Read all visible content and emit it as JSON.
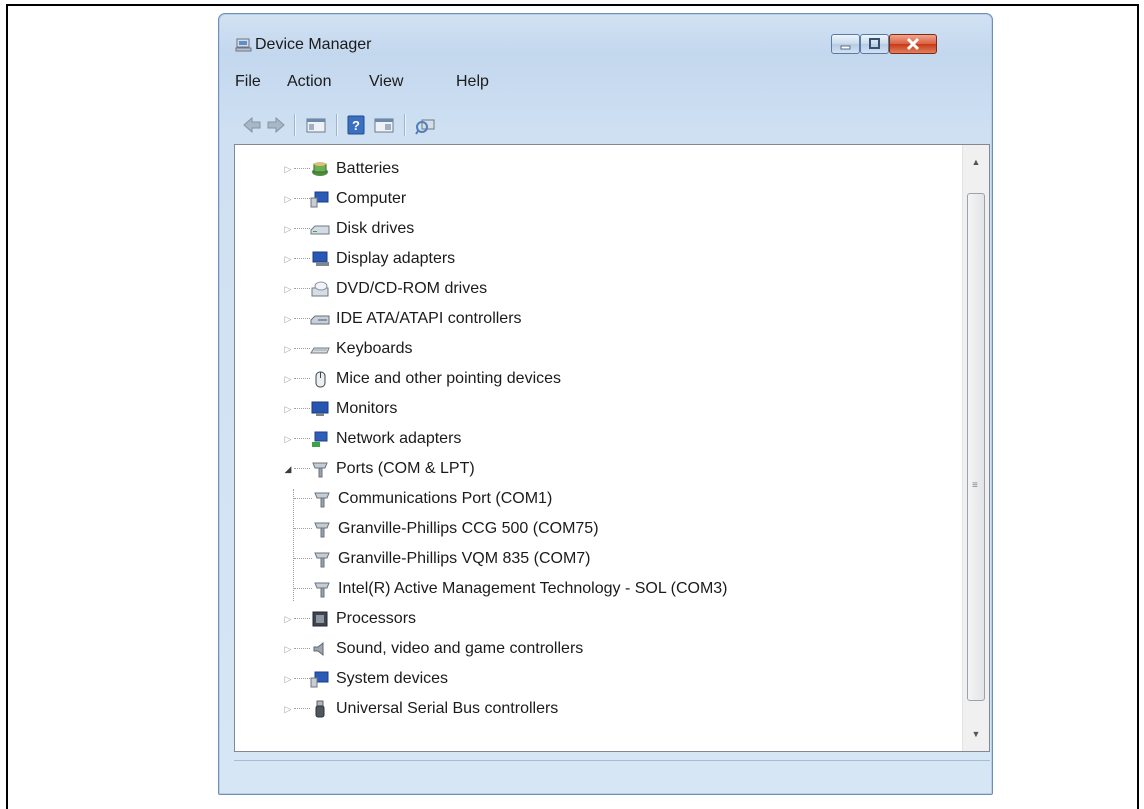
{
  "window": {
    "title": "Device Manager"
  },
  "menu": {
    "items": [
      "File",
      "Action",
      "View",
      "Help"
    ]
  },
  "toolbar": {
    "icons": [
      "back-arrow-icon",
      "forward-arrow-icon",
      "show-hide-console-tree-icon",
      "help-icon",
      "properties-icon",
      "scan-hardware-icon"
    ]
  },
  "tree": {
    "categories": [
      {
        "label": "Batteries",
        "icon": "battery-icon",
        "expanded": false
      },
      {
        "label": "Computer",
        "icon": "computer-icon",
        "expanded": false
      },
      {
        "label": "Disk drives",
        "icon": "disk-drive-icon",
        "expanded": false
      },
      {
        "label": "Display adapters",
        "icon": "display-adapter-icon",
        "expanded": false
      },
      {
        "label": "DVD/CD-ROM drives",
        "icon": "dvd-drive-icon",
        "expanded": false
      },
      {
        "label": "IDE ATA/ATAPI controllers",
        "icon": "ide-controller-icon",
        "expanded": false
      },
      {
        "label": "Keyboards",
        "icon": "keyboard-icon",
        "expanded": false
      },
      {
        "label": "Mice and other pointing devices",
        "icon": "mouse-icon",
        "expanded": false
      },
      {
        "label": "Monitors",
        "icon": "monitor-icon",
        "expanded": false
      },
      {
        "label": "Network adapters",
        "icon": "network-adapter-icon",
        "expanded": false
      },
      {
        "label": "Ports (COM & LPT)",
        "icon": "port-icon",
        "expanded": true,
        "children": [
          {
            "label": "Communications Port (COM1)",
            "icon": "port-icon"
          },
          {
            "label": "Granville-Phillips CCG 500 (COM75)",
            "icon": "port-icon"
          },
          {
            "label": "Granville-Phillips VQM 835 (COM7)",
            "icon": "port-icon"
          },
          {
            "label": "Intel(R) Active Management Technology - SOL (COM3)",
            "icon": "port-icon"
          }
        ]
      },
      {
        "label": "Processors",
        "icon": "processor-icon",
        "expanded": false
      },
      {
        "label": "Sound, video and game controllers",
        "icon": "speaker-icon",
        "expanded": false
      },
      {
        "label": "System devices",
        "icon": "system-device-icon",
        "expanded": false
      },
      {
        "label": "Universal Serial Bus controllers",
        "icon": "usb-icon",
        "expanded": false
      }
    ]
  },
  "colors": {
    "title_bar": "#c3d7ee",
    "close_button": "#c73a17",
    "pane_bg": "#ffffff"
  }
}
